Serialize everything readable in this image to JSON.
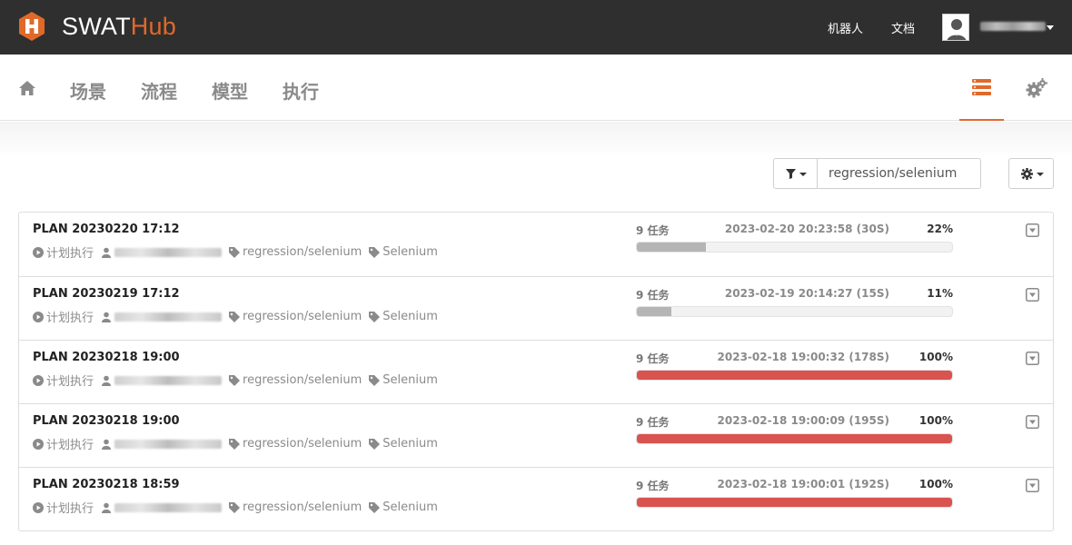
{
  "app": {
    "logo": {
      "part1": "SWAT",
      "part2": "Hub"
    },
    "colors": {
      "accent": "#e0692a",
      "navbar": "#2f2f2f",
      "progress_done": "#d9534f",
      "progress_partial": "#b5b5b5"
    }
  },
  "topbar": {
    "robots_label": "机器人",
    "docs_label": "文档",
    "user_menu_icon": "chevron-down-icon"
  },
  "subnav": {
    "items": [
      {
        "label": "场景"
      },
      {
        "label": "流程"
      },
      {
        "label": "模型"
      },
      {
        "label": "执行"
      }
    ]
  },
  "filter": {
    "value": "regression/selenium",
    "icon": "filter-icon"
  },
  "rows": [
    {
      "title": "PLAN 20230220 17:12",
      "trigger": "计划执行",
      "tag1": "regression/selenium",
      "tag2": "Selenium",
      "tasks": "9 任务",
      "time": "2023-02-20 20:23:58 (30S)",
      "percent_label": "22%",
      "progress": 0.22,
      "status": "partial"
    },
    {
      "title": "PLAN 20230219 17:12",
      "trigger": "计划执行",
      "tag1": "regression/selenium",
      "tag2": "Selenium",
      "tasks": "9 任务",
      "time": "2023-02-19 20:14:27 (15S)",
      "percent_label": "11%",
      "progress": 0.11,
      "status": "partial"
    },
    {
      "title": "PLAN 20230218 19:00",
      "trigger": "计划执行",
      "tag1": "regression/selenium",
      "tag2": "Selenium",
      "tasks": "9 任务",
      "time": "2023-02-18 19:00:32 (178S)",
      "percent_label": "100%",
      "progress": 1.0,
      "status": "done"
    },
    {
      "title": "PLAN 20230218 19:00",
      "trigger": "计划执行",
      "tag1": "regression/selenium",
      "tag2": "Selenium",
      "tasks": "9 任务",
      "time": "2023-02-18 19:00:09 (195S)",
      "percent_label": "100%",
      "progress": 1.0,
      "status": "done"
    },
    {
      "title": "PLAN 20230218 18:59",
      "trigger": "计划执行",
      "tag1": "regression/selenium",
      "tag2": "Selenium",
      "tasks": "9 任务",
      "time": "2023-02-18 19:00:01 (192S)",
      "percent_label": "100%",
      "progress": 1.0,
      "status": "done"
    }
  ]
}
